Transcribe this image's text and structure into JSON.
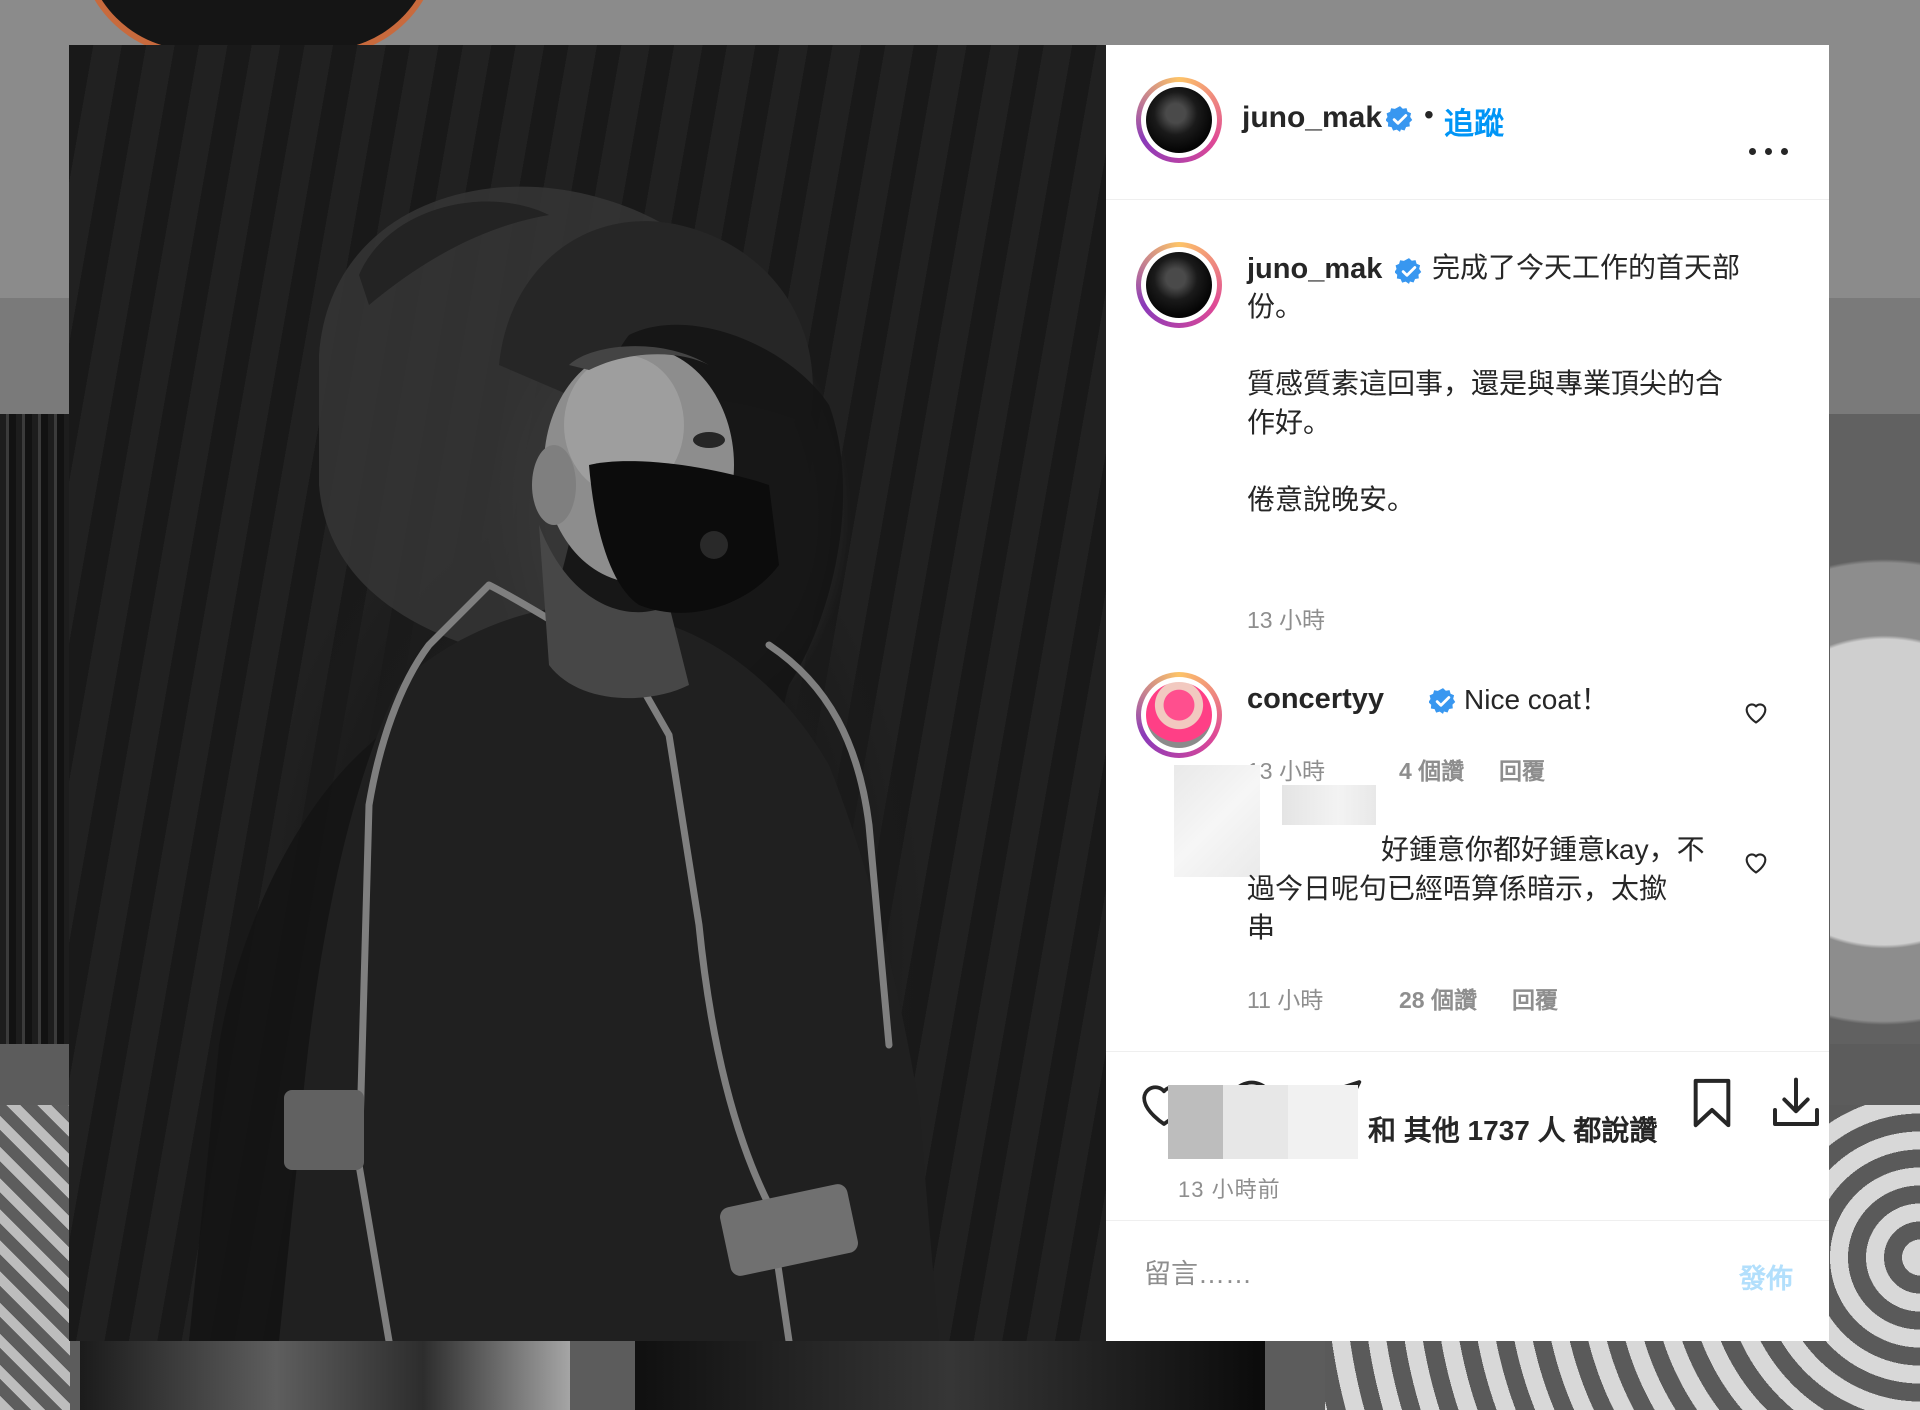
{
  "post": {
    "author": "juno_mak",
    "follow_label": "追蹤",
    "separator": "•",
    "caption": {
      "line1": "完成了今天工作的首天部",
      "line2": "份。",
      "line3": "質感質素這回事，還是與專業頂尖的合",
      "line4": "作好。",
      "line5": "倦意說晚安。"
    },
    "caption_time": "13 小時"
  },
  "comments": [
    {
      "user": "concertyy",
      "text": "Nice coat！",
      "time": "13 小時",
      "likes": "4 個讚",
      "reply": "回覆"
    },
    {
      "user": "",
      "line1": "好鍾意你都好鍾意kay，不",
      "line2": "過今日呢句已經唔算係暗示，太撳",
      "line3": "串",
      "time": "11 小時",
      "likes": "28 個讚",
      "reply": "回覆"
    }
  ],
  "likes_summary": "和 其他 1737 人 都說讚",
  "posted_ago": "13 小時前",
  "comment_box": {
    "placeholder": "留言……",
    "post_label": "發佈"
  },
  "icons": {
    "like": "heart-icon",
    "comment": "comment-bubble-icon",
    "share": "paper-plane-icon",
    "save": "bookmark-icon",
    "download": "download-icon",
    "more": "ellipsis-icon",
    "verified": "verified-badge-icon"
  },
  "colors": {
    "accent_link": "#0095f6",
    "verified": "#3897f0",
    "text": "#262626",
    "muted": "#8e8e8e",
    "post_disabled": "#b2dffc"
  }
}
